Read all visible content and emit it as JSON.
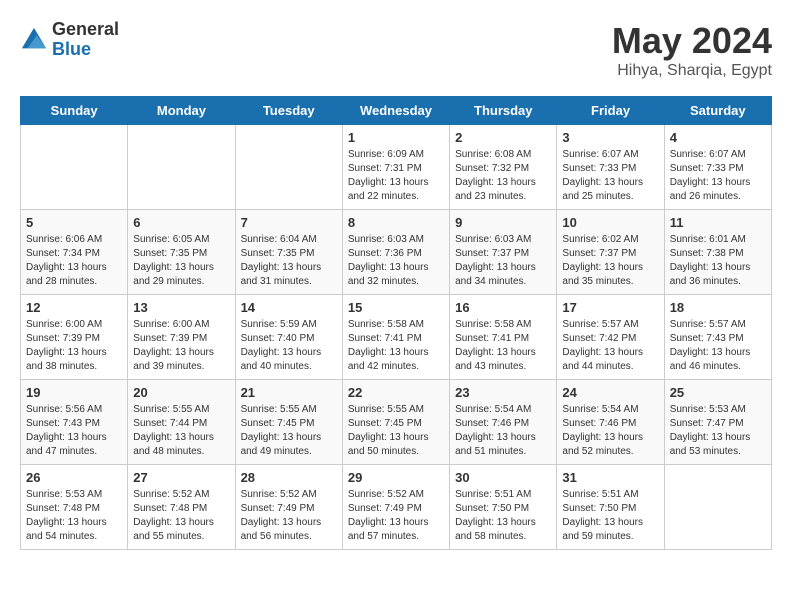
{
  "header": {
    "logo_general": "General",
    "logo_blue": "Blue",
    "title": "May 2024",
    "subtitle": "Hihya, Sharqia, Egypt"
  },
  "weekdays": [
    "Sunday",
    "Monday",
    "Tuesday",
    "Wednesday",
    "Thursday",
    "Friday",
    "Saturday"
  ],
  "weeks": [
    [
      {
        "day": "",
        "info": ""
      },
      {
        "day": "",
        "info": ""
      },
      {
        "day": "",
        "info": ""
      },
      {
        "day": "1",
        "info": "Sunrise: 6:09 AM\nSunset: 7:31 PM\nDaylight: 13 hours\nand 22 minutes."
      },
      {
        "day": "2",
        "info": "Sunrise: 6:08 AM\nSunset: 7:32 PM\nDaylight: 13 hours\nand 23 minutes."
      },
      {
        "day": "3",
        "info": "Sunrise: 6:07 AM\nSunset: 7:33 PM\nDaylight: 13 hours\nand 25 minutes."
      },
      {
        "day": "4",
        "info": "Sunrise: 6:07 AM\nSunset: 7:33 PM\nDaylight: 13 hours\nand 26 minutes."
      }
    ],
    [
      {
        "day": "5",
        "info": "Sunrise: 6:06 AM\nSunset: 7:34 PM\nDaylight: 13 hours\nand 28 minutes."
      },
      {
        "day": "6",
        "info": "Sunrise: 6:05 AM\nSunset: 7:35 PM\nDaylight: 13 hours\nand 29 minutes."
      },
      {
        "day": "7",
        "info": "Sunrise: 6:04 AM\nSunset: 7:35 PM\nDaylight: 13 hours\nand 31 minutes."
      },
      {
        "day": "8",
        "info": "Sunrise: 6:03 AM\nSunset: 7:36 PM\nDaylight: 13 hours\nand 32 minutes."
      },
      {
        "day": "9",
        "info": "Sunrise: 6:03 AM\nSunset: 7:37 PM\nDaylight: 13 hours\nand 34 minutes."
      },
      {
        "day": "10",
        "info": "Sunrise: 6:02 AM\nSunset: 7:37 PM\nDaylight: 13 hours\nand 35 minutes."
      },
      {
        "day": "11",
        "info": "Sunrise: 6:01 AM\nSunset: 7:38 PM\nDaylight: 13 hours\nand 36 minutes."
      }
    ],
    [
      {
        "day": "12",
        "info": "Sunrise: 6:00 AM\nSunset: 7:39 PM\nDaylight: 13 hours\nand 38 minutes."
      },
      {
        "day": "13",
        "info": "Sunrise: 6:00 AM\nSunset: 7:39 PM\nDaylight: 13 hours\nand 39 minutes."
      },
      {
        "day": "14",
        "info": "Sunrise: 5:59 AM\nSunset: 7:40 PM\nDaylight: 13 hours\nand 40 minutes."
      },
      {
        "day": "15",
        "info": "Sunrise: 5:58 AM\nSunset: 7:41 PM\nDaylight: 13 hours\nand 42 minutes."
      },
      {
        "day": "16",
        "info": "Sunrise: 5:58 AM\nSunset: 7:41 PM\nDaylight: 13 hours\nand 43 minutes."
      },
      {
        "day": "17",
        "info": "Sunrise: 5:57 AM\nSunset: 7:42 PM\nDaylight: 13 hours\nand 44 minutes."
      },
      {
        "day": "18",
        "info": "Sunrise: 5:57 AM\nSunset: 7:43 PM\nDaylight: 13 hours\nand 46 minutes."
      }
    ],
    [
      {
        "day": "19",
        "info": "Sunrise: 5:56 AM\nSunset: 7:43 PM\nDaylight: 13 hours\nand 47 minutes."
      },
      {
        "day": "20",
        "info": "Sunrise: 5:55 AM\nSunset: 7:44 PM\nDaylight: 13 hours\nand 48 minutes."
      },
      {
        "day": "21",
        "info": "Sunrise: 5:55 AM\nSunset: 7:45 PM\nDaylight: 13 hours\nand 49 minutes."
      },
      {
        "day": "22",
        "info": "Sunrise: 5:55 AM\nSunset: 7:45 PM\nDaylight: 13 hours\nand 50 minutes."
      },
      {
        "day": "23",
        "info": "Sunrise: 5:54 AM\nSunset: 7:46 PM\nDaylight: 13 hours\nand 51 minutes."
      },
      {
        "day": "24",
        "info": "Sunrise: 5:54 AM\nSunset: 7:46 PM\nDaylight: 13 hours\nand 52 minutes."
      },
      {
        "day": "25",
        "info": "Sunrise: 5:53 AM\nSunset: 7:47 PM\nDaylight: 13 hours\nand 53 minutes."
      }
    ],
    [
      {
        "day": "26",
        "info": "Sunrise: 5:53 AM\nSunset: 7:48 PM\nDaylight: 13 hours\nand 54 minutes."
      },
      {
        "day": "27",
        "info": "Sunrise: 5:52 AM\nSunset: 7:48 PM\nDaylight: 13 hours\nand 55 minutes."
      },
      {
        "day": "28",
        "info": "Sunrise: 5:52 AM\nSunset: 7:49 PM\nDaylight: 13 hours\nand 56 minutes."
      },
      {
        "day": "29",
        "info": "Sunrise: 5:52 AM\nSunset: 7:49 PM\nDaylight: 13 hours\nand 57 minutes."
      },
      {
        "day": "30",
        "info": "Sunrise: 5:51 AM\nSunset: 7:50 PM\nDaylight: 13 hours\nand 58 minutes."
      },
      {
        "day": "31",
        "info": "Sunrise: 5:51 AM\nSunset: 7:50 PM\nDaylight: 13 hours\nand 59 minutes."
      },
      {
        "day": "",
        "info": ""
      }
    ]
  ]
}
